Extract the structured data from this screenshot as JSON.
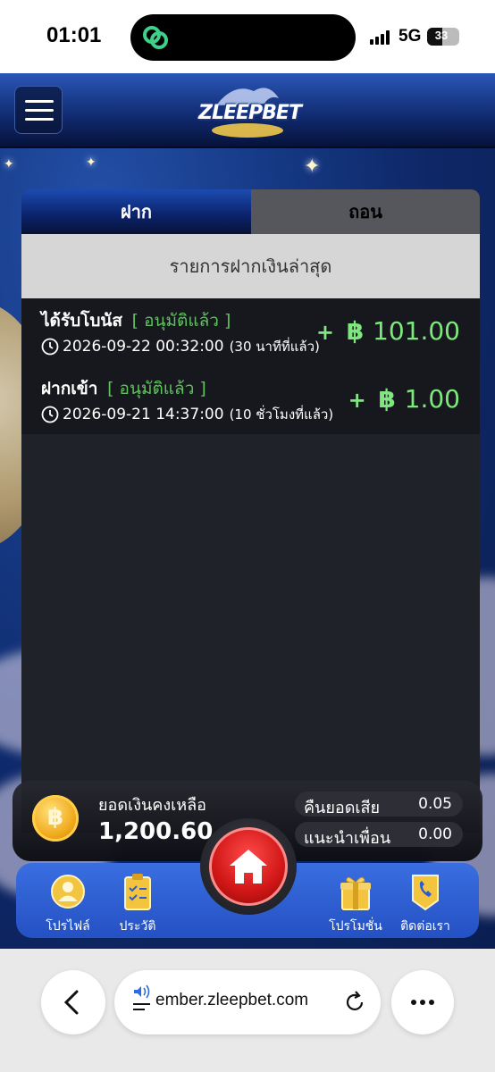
{
  "status_bar": {
    "time": "01:01",
    "network": "5G",
    "battery": "33"
  },
  "header": {
    "logo_text": "ZLEEPBET"
  },
  "tabs": {
    "deposit": "ฝาก",
    "withdraw": "ถอน",
    "active": "deposit"
  },
  "section_title": "รายการฝากเงินล่าสุด",
  "transactions": [
    {
      "title": "ได้รับโบนัส",
      "status": "[ อนุมัติแล้ว ]",
      "datetime": "2026-09-22 00:32:00",
      "ago": "(30 นาทีที่แล้ว)",
      "sign": "+",
      "currency": "฿",
      "amount": "101.00"
    },
    {
      "title": "ฝากเข้า",
      "status": "[ อนุมัติแล้ว ]",
      "datetime": "2026-09-21 14:37:00",
      "ago": "(10 ชั่วโมงที่แล้ว)",
      "sign": "+",
      "currency": "฿",
      "amount": "1.00"
    }
  ],
  "balance": {
    "coin_symbol": "฿",
    "label": "ยอดเงินคงเหลือ",
    "value": "1,200.60",
    "cashback_label": "คืนยอดเสีย",
    "cashback_value": "0.05",
    "referral_label": "แนะนำเพื่อน",
    "referral_value": "0.00"
  },
  "nav": {
    "profile": "โปรไฟล์",
    "history": "ประวัติ",
    "promotion": "โปรโมชั่น",
    "contact": "ติดต่อเรา"
  },
  "browser": {
    "url": "ember.zleepbet.com"
  },
  "colors": {
    "approved": "#5fc25f",
    "amount": "#7ee87e",
    "nav_bg": "#2f60d8",
    "home": "#d01616"
  }
}
